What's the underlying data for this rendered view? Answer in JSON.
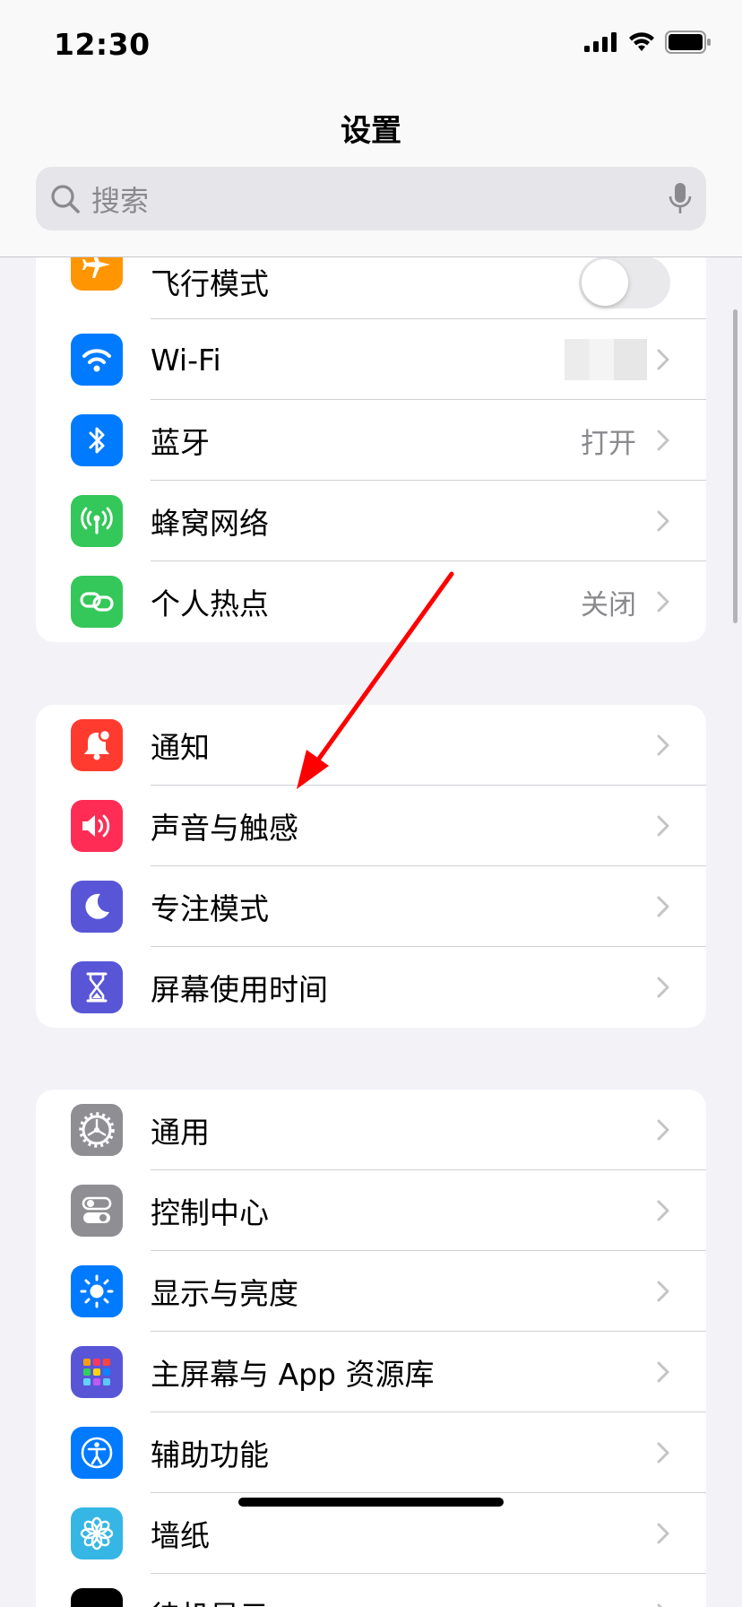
{
  "status_bar": {
    "time": "12:30"
  },
  "nav": {
    "title": "设置"
  },
  "search": {
    "placeholder": "搜索"
  },
  "group1": [
    {
      "label": "飞行模式",
      "icon": "airplane-icon",
      "color": "#ff9500",
      "toggle": false
    },
    {
      "label": "Wi-Fi",
      "icon": "wifi-icon",
      "color": "#007aff",
      "value": ""
    },
    {
      "label": "蓝牙",
      "icon": "bluetooth-icon",
      "color": "#007aff",
      "value": "打开"
    },
    {
      "label": "蜂窝网络",
      "icon": "cellular-icon",
      "color": "#34c759",
      "value": ""
    },
    {
      "label": "个人热点",
      "icon": "hotspot-icon",
      "color": "#34c759",
      "value": "关闭"
    }
  ],
  "group2": [
    {
      "label": "通知",
      "icon": "bell-icon",
      "color": "#ff3b30"
    },
    {
      "label": "声音与触感",
      "icon": "speaker-icon",
      "color": "#ff2d55"
    },
    {
      "label": "专注模式",
      "icon": "moon-icon",
      "color": "#5856d6"
    },
    {
      "label": "屏幕使用时间",
      "icon": "hourglass-icon",
      "color": "#5856d6"
    }
  ],
  "group3": [
    {
      "label": "通用",
      "icon": "gear-icon",
      "color": "#8e8e93"
    },
    {
      "label": "控制中心",
      "icon": "switches-icon",
      "color": "#8e8e93"
    },
    {
      "label": "显示与亮度",
      "icon": "sun-icon",
      "color": "#007aff"
    },
    {
      "label": "主屏幕与 App 资源库",
      "icon": "home-grid-icon",
      "color": "#5856d6"
    },
    {
      "label": "辅助功能",
      "icon": "accessibility-icon",
      "color": "#007aff"
    },
    {
      "label": "墙纸",
      "icon": "flower-icon",
      "color": "#36b6e4"
    },
    {
      "label": "待机显示",
      "icon": "standby-icon",
      "color": "#000000"
    }
  ],
  "annotation": {
    "arrow_color": "#ff0000"
  }
}
